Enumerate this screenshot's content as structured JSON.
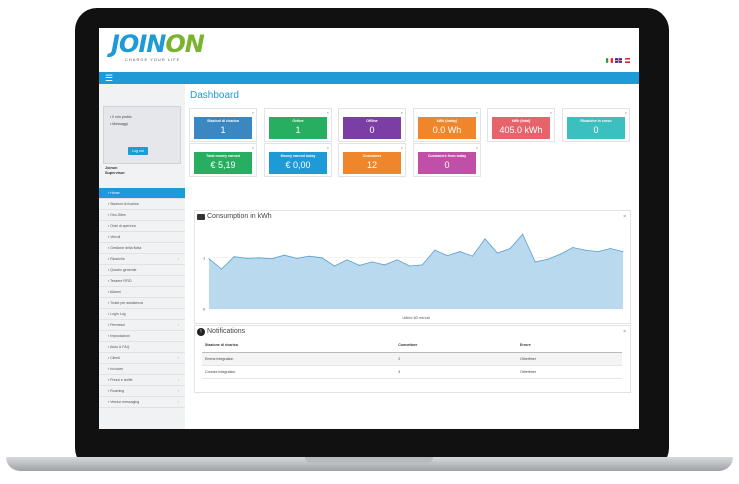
{
  "header": {
    "logo_text": "Joinon",
    "tagline": "CHARGE YOUR LIFE",
    "menu_icon": "hamburger-icon",
    "flags": [
      "it",
      "gb",
      "at"
    ]
  },
  "sidebar": {
    "profile_links": [
      "Il mio profilo",
      "Messaggi"
    ],
    "logout_label": "Log out",
    "user_name": "Joinon",
    "user_role": "Supervisor",
    "items": [
      {
        "label": "Home",
        "active": true,
        "chevron": ""
      },
      {
        "label": "Stazioni di ricarica",
        "active": false,
        "chevron": ""
      },
      {
        "label": "Geo-Sites",
        "active": false,
        "chevron": ""
      },
      {
        "label": "Orari di apertura",
        "active": false,
        "chevron": ""
      },
      {
        "label": "Veicoli",
        "active": false,
        "chevron": ""
      },
      {
        "label": "Gestione della flotta",
        "active": false,
        "chevron": ""
      },
      {
        "label": "Ricariche",
        "active": false,
        "chevron": "›"
      },
      {
        "label": "Quadro generale",
        "active": false,
        "chevron": ""
      },
      {
        "label": "Tessere RFID",
        "active": false,
        "chevron": ""
      },
      {
        "label": "Allarmi",
        "active": false,
        "chevron": ""
      },
      {
        "label": "Ticket per assistenza",
        "active": false,
        "chevron": ""
      },
      {
        "label": "Login Log",
        "active": false,
        "chevron": ""
      },
      {
        "label": "Permessi",
        "active": false,
        "chevron": "›"
      },
      {
        "label": "Impostazioni",
        "active": false,
        "chevron": ""
      },
      {
        "label": "Aiuto & FAQ",
        "active": false,
        "chevron": ""
      },
      {
        "label": "Clienti",
        "active": false,
        "chevron": "›"
      },
      {
        "label": "Invoices",
        "active": false,
        "chevron": ""
      },
      {
        "label": "Prezzi e tariffe",
        "active": false,
        "chevron": "›"
      },
      {
        "label": "Roaming",
        "active": false,
        "chevron": "›"
      },
      {
        "label": "Vendor messaging",
        "active": false,
        "chevron": "›"
      }
    ]
  },
  "main": {
    "title": "Dashboard",
    "close_glyph": "×",
    "tiles": [
      {
        "label": "Stazioni di ricarica",
        "value": "1",
        "color": "#3a87c2"
      },
      {
        "label": "Online",
        "value": "1",
        "color": "#27ae60"
      },
      {
        "label": "Offline",
        "value": "0",
        "color": "#7b3ea4"
      },
      {
        "label": "kWh (today)",
        "value": "0.0 Wh",
        "color": "#f0862c"
      },
      {
        "label": "kWh (total)",
        "value": "405.0 kWh",
        "color": "#e6636b"
      },
      {
        "label": "Ricariche in corso",
        "value": "0",
        "color": "#3cbfbf"
      },
      {
        "label": "Total money earned",
        "value": "€ 5,19",
        "color": "#27ae60"
      },
      {
        "label": "Money earned today",
        "value": "€ 0,00",
        "color": "#1e9ad6"
      },
      {
        "label": "Customers",
        "value": "12",
        "color": "#f0862c"
      },
      {
        "label": "Customers from today",
        "value": "0",
        "color": "#c04fa8"
      }
    ]
  },
  "consumption": {
    "title": "Consumption in kWh",
    "icon": "battery-icon",
    "caption": "Ultimi 60 minuti",
    "chart_data": {
      "type": "area",
      "x": [
        1,
        2,
        3,
        4,
        5,
        6,
        7,
        8,
        9,
        10,
        11,
        12,
        13,
        14,
        15,
        16,
        17,
        18,
        19,
        20,
        21,
        22,
        23,
        24,
        25,
        26,
        27,
        28,
        29,
        30,
        31,
        32,
        33,
        34
      ],
      "values": [
        0.98,
        0.78,
        1.02,
        0.99,
        1.0,
        0.98,
        1.05,
        0.99,
        1.03,
        1.0,
        0.84,
        0.96,
        0.85,
        0.92,
        0.86,
        0.96,
        0.84,
        0.86,
        1.15,
        1.04,
        1.12,
        1.03,
        1.37,
        1.09,
        1.18,
        1.46,
        0.92,
        0.97,
        1.07,
        1.2,
        1.15,
        1.12,
        1.18,
        1.12
      ],
      "ylim": [
        0,
        1.6
      ],
      "y_tick_labels": [
        "1",
        "0"
      ],
      "y_ticks": [
        1,
        0
      ],
      "fill_color": "#b9d9ee",
      "line_color": "#5a9fd1",
      "grid": true
    }
  },
  "notifications": {
    "title": "Notifications",
    "icon": "exclamation-icon",
    "columns": [
      "Stazione di ricarica",
      "Connettore",
      "Errore"
    ],
    "rows": [
      [
        "Emma Integration",
        "2",
        "Otherfiner"
      ],
      [
        "Connex Integration",
        "4",
        "Otherfiner"
      ]
    ]
  }
}
